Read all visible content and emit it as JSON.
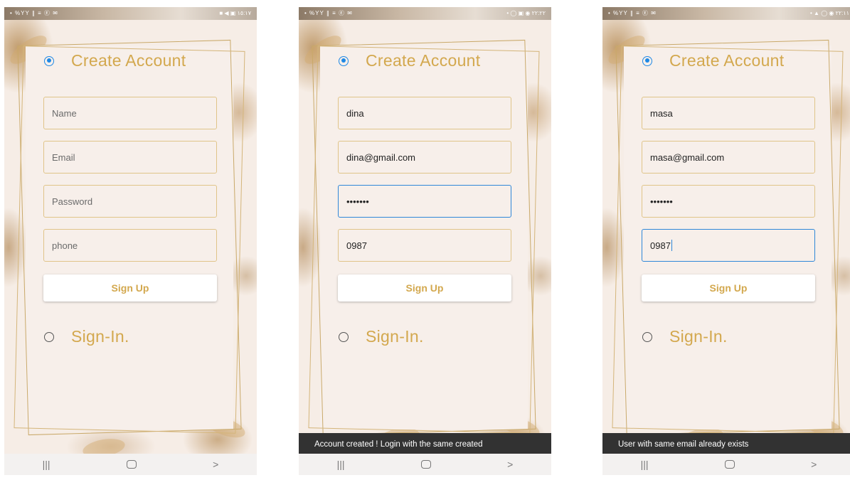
{
  "screens": [
    {
      "status_left": "• %YY ∥ ≡ Ⓔ ✉",
      "status_right": "■ ◀ ▣ ١٥:١٧",
      "create_account_label": "Create Account",
      "signin_label": "Sign-In.",
      "fields": {
        "name": {
          "value": "",
          "placeholder": "Name"
        },
        "email": {
          "value": "",
          "placeholder": "Email"
        },
        "password": {
          "value": "",
          "placeholder": "Password"
        },
        "phone": {
          "value": "",
          "placeholder": "phone"
        }
      },
      "signup_label": "Sign Up",
      "snackbar": ""
    },
    {
      "status_left": "• %YY ∥ ≡ Ⓔ ✉",
      "status_right": "• ◯ ▣ ◉ ٢٢:٢٢",
      "create_account_label": "Create Account",
      "signin_label": "Sign-In.",
      "fields": {
        "name": {
          "value": "dina",
          "placeholder": "Name"
        },
        "email": {
          "value": "dina@gmail.com",
          "placeholder": "Email"
        },
        "password": {
          "value": "•••••••",
          "placeholder": "Password"
        },
        "phone": {
          "value": "0987",
          "placeholder": "phone"
        }
      },
      "signup_label": "Sign Up",
      "snackbar": "Account created ! Login with the same created"
    },
    {
      "status_left": "• %YY ∥ ≡ Ⓔ ✉",
      "status_right": "• ▲ ◯ ◉ ٢٢:١١",
      "create_account_label": "Create Account",
      "signin_label": "Sign-In.",
      "fields": {
        "name": {
          "value": "masa",
          "placeholder": "Name"
        },
        "email": {
          "value": "masa@gmail.com",
          "placeholder": "Email"
        },
        "password": {
          "value": "•••••••",
          "placeholder": "Password"
        },
        "phone": {
          "value": "0987",
          "placeholder": "phone"
        }
      },
      "signup_label": "Sign Up",
      "snackbar": "User with same email already exists"
    }
  ],
  "nav": {
    "recents_icon": "|||",
    "home_icon": "home-icon",
    "back_icon": ">"
  },
  "colors": {
    "accent": "#d3a84e",
    "focus": "#2f87d8",
    "snackbar_bg": "#323232"
  }
}
